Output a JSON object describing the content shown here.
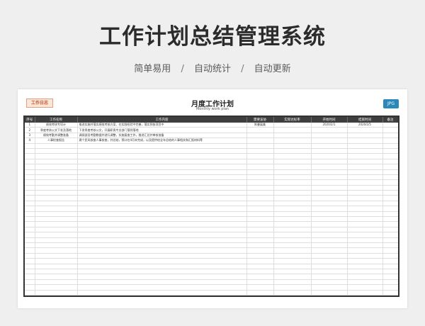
{
  "page": {
    "title": "工作计划总结管理系统",
    "features": [
      "简单易用",
      "自动统计",
      "自动更新"
    ],
    "separator": "/"
  },
  "sheet": {
    "logo_text": "工作日志",
    "title": "月度工作计划",
    "subtitle": "Monthly work plan",
    "badge": "JPG",
    "columns": [
      "序号",
      "工作名称",
      "工作内容",
      "需要该协",
      "实际达标率",
      "开始时间",
      "结束时间",
      "备注"
    ],
    "rows": [
      [
        "1",
        "绩效考核专项计",
        "推进实施并落实绩效考核方案、在实践检验中完善，落实到各项目中",
        "陈曼展美",
        "",
        "2020/2/1",
        "2020/2/5",
        ""
      ],
      [
        "2",
        "季度考核公文下发及落地",
        "下发季度考核公文，开展职责专业部门落到落地",
        "",
        "",
        "",
        "",
        ""
      ],
      [
        "3",
        "绩效考勤并调整准备",
        "调阅部员考勤数据并进行调整，实施复查工作，推进汇总并审核准备",
        "",
        "",
        "",
        "",
        ""
      ],
      [
        "4",
        "人事检查报告",
        "建个民风核查人事核查，并总结，预计在4月末完成，以及提供给全年总结的人事相关和汇报材料等",
        "",
        "",
        "",
        "",
        ""
      ]
    ],
    "empty_rows": 34
  }
}
